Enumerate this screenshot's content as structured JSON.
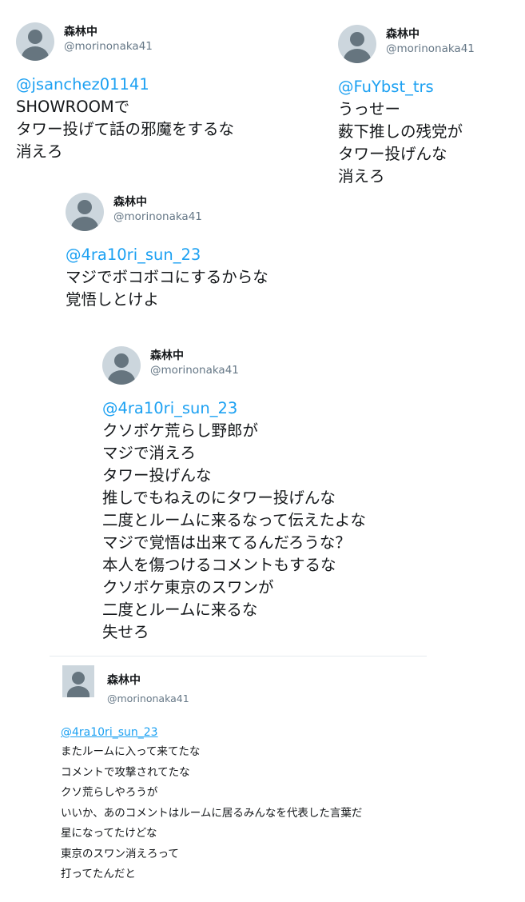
{
  "tweets": [
    {
      "name": "森林中",
      "handle": "@morinonaka41",
      "mention": "@jsanchez01141",
      "lines": [
        "SHOWROOMで",
        "タワー投げて話の邪魔をするな",
        "消えろ"
      ]
    },
    {
      "name": "森林中",
      "handle": "@morinonaka41",
      "mention": "@FuYbst_trs",
      "lines": [
        "うっせー",
        "薮下推しの残党が",
        "タワー投げんな",
        "消えろ"
      ]
    },
    {
      "name": "森林中",
      "handle": "@morinonaka41",
      "mention": "@4ra10ri_sun_23",
      "lines": [
        "マジでボコボコにするからな",
        "覚悟しとけよ"
      ]
    },
    {
      "name": "森林中",
      "handle": "@morinonaka41",
      "mention": "@4ra10ri_sun_23",
      "lines": [
        "クソボケ荒らし野郎が",
        "マジで消えろ",
        "タワー投げんな",
        "推しでもねえのにタワー投げんな",
        "二度とルームに来るなって伝えたよな",
        "マジで覚悟は出来てるんだろうな？",
        "本人を傷つけるコメントもするな",
        "クソボケ東京のスワンが",
        "二度とルームに来るな",
        "失せろ"
      ]
    },
    {
      "name": "森林中",
      "handle": "@morinonaka41",
      "mention": "@4ra10ri_sun_23",
      "lines": [
        "またルームに入って来てたな",
        "コメントで攻撃されてたな",
        "クソ荒らしやろうが",
        "いいか、あのコメントはルームに居るみんなを代表した言葉だ",
        "星になってたけどな",
        "東京のスワン消えろって",
        "打ってたんだと"
      ]
    }
  ]
}
